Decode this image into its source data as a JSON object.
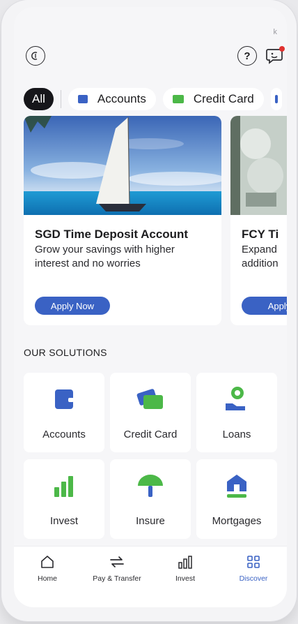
{
  "status": {
    "indicator": "k"
  },
  "header": {
    "back_icon": "back-circle-icon",
    "help_label": "?",
    "chat_icon": "chat-notification-icon"
  },
  "chips": [
    {
      "label": "All",
      "active": true
    },
    {
      "label": "Accounts",
      "icon": "wallet-icon",
      "color": "#3a62c4"
    },
    {
      "label": "Credit Card",
      "icon": "card-icon",
      "color": "#4cb848"
    }
  ],
  "promos": [
    {
      "title": "SGD Time Deposit Account",
      "subtitle": "Grow your savings with higher interest and no worries",
      "button": "Apply Now"
    },
    {
      "title": "FCY Ti",
      "subtitle": "Expand addition",
      "button": "Apply"
    }
  ],
  "solutions": {
    "title": "OUR SOLUTIONS",
    "tiles": [
      {
        "label": "Accounts"
      },
      {
        "label": "Credit Card"
      },
      {
        "label": "Loans"
      },
      {
        "label": "Invest"
      },
      {
        "label": "Insure"
      },
      {
        "label": "Mortgages"
      }
    ]
  },
  "nav": [
    {
      "label": "Home"
    },
    {
      "label": "Pay & Transfer"
    },
    {
      "label": "Invest"
    },
    {
      "label": "Discover",
      "active": true
    }
  ],
  "colors": {
    "brand_blue": "#3a62c4",
    "brand_green": "#4cb848",
    "notification": "#e0312f"
  }
}
